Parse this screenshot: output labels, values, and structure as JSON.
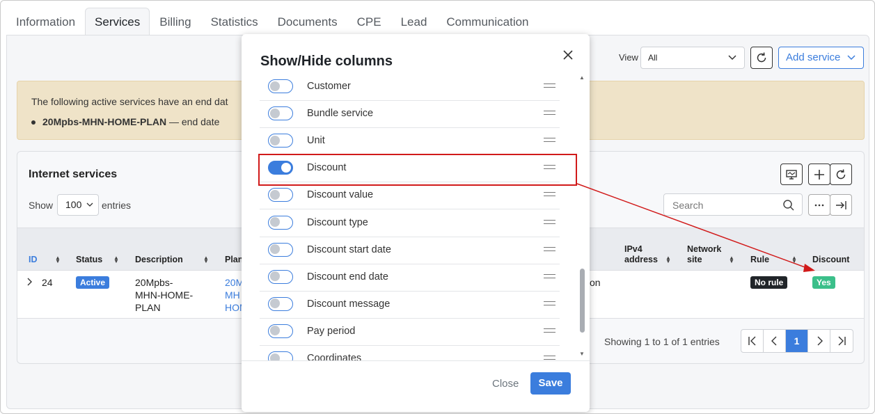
{
  "tabs": [
    "Information",
    "Services",
    "Billing",
    "Statistics",
    "Documents",
    "CPE",
    "Lead",
    "Communication"
  ],
  "toolbar": {
    "view_label": "View",
    "view_value": "All",
    "add_service_label": "Add service"
  },
  "alert": {
    "text": "The following active services have an end dat",
    "item_name": "20Mpbs-MHN-HOME-PLAN",
    "item_rest": " — end date"
  },
  "card": {
    "title": "Internet services",
    "show_label": "Show",
    "show_value": "100",
    "entries_label": "entries",
    "search_placeholder": "Search"
  },
  "table": {
    "headers": [
      "ID",
      "Status",
      "Description",
      "Plan",
      "IPv4 address",
      "Network site",
      "Rule",
      "Discount"
    ],
    "row": {
      "id": "24",
      "status": "Active",
      "description_lines": [
        "20Mpbs-",
        "MHN-HOME-",
        "PLAN"
      ],
      "plan_lines": [
        "20M",
        "MH",
        "HOM"
      ],
      "partial": "on",
      "rule": "No rule",
      "discount": "Yes"
    },
    "showing": "Showing 1 to 1 of 1 entries",
    "current_page": "1"
  },
  "modal": {
    "title": "Show/Hide columns",
    "columns": [
      {
        "label": "Customer",
        "on": false
      },
      {
        "label": "Bundle service",
        "on": false
      },
      {
        "label": "Unit",
        "on": false
      },
      {
        "label": "Discount",
        "on": true
      },
      {
        "label": "Discount value",
        "on": false
      },
      {
        "label": "Discount type",
        "on": false
      },
      {
        "label": "Discount start date",
        "on": false
      },
      {
        "label": "Discount end date",
        "on": false
      },
      {
        "label": "Discount message",
        "on": false
      },
      {
        "label": "Pay period",
        "on": false
      },
      {
        "label": "Coordinates",
        "on": false
      }
    ],
    "close_label": "Close",
    "save_label": "Save"
  },
  "colors": {
    "accent": "#3b7ddd",
    "annotation": "#d11a1a",
    "success": "#3bbf8a"
  }
}
